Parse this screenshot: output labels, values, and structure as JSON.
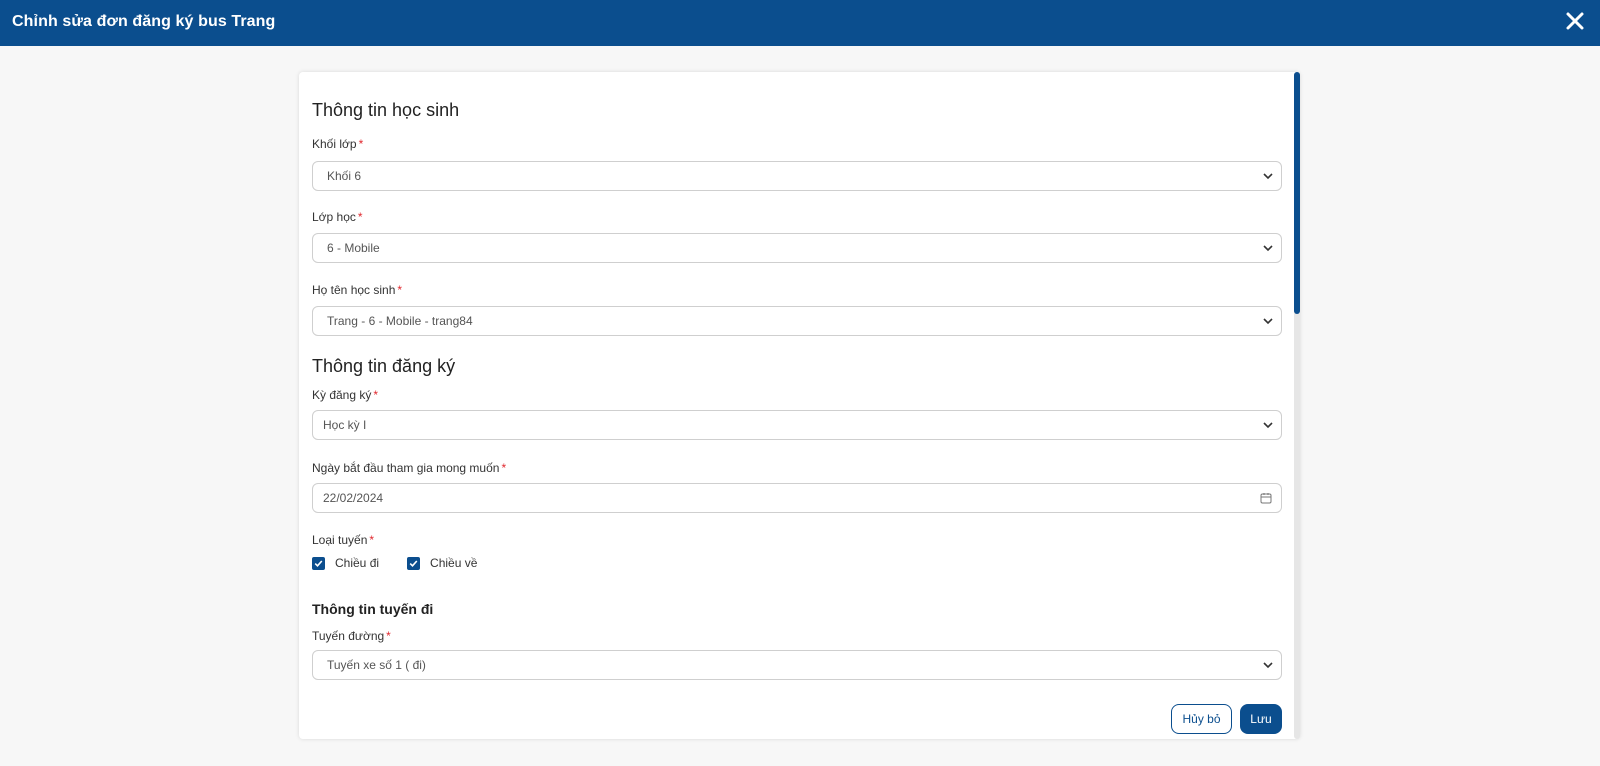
{
  "header": {
    "title": "Chỉnh sửa đơn đăng ký bus Trang",
    "close_icon": "close-icon"
  },
  "student_section": {
    "title": "Thông tin học sinh",
    "grade": {
      "label": "Khối lớp",
      "required": "*",
      "value": "Khối 6"
    },
    "class": {
      "label": "Lớp học",
      "required": "*",
      "value": "6 - Mobile"
    },
    "student": {
      "label": "Họ tên học sinh",
      "required": "*",
      "value": "Trang - 6 - Mobile - trang84"
    }
  },
  "registration_section": {
    "title": "Thông tin đăng ký",
    "term": {
      "label": "Kỳ đăng ký",
      "required": "*",
      "value": "Học kỳ I"
    },
    "start_date": {
      "label": "Ngày bắt đầu tham gia mong muốn",
      "required": "*",
      "value": "22/02/2024"
    },
    "route_type": {
      "label": "Loại tuyến",
      "required": "*",
      "options": [
        {
          "label": "Chiều đi",
          "checked": true
        },
        {
          "label": "Chiều về",
          "checked": true
        }
      ]
    }
  },
  "outbound_section": {
    "title": "Thông tin tuyến đi",
    "route": {
      "label": "Tuyến đường",
      "required": "*",
      "value": "Tuyến xe số 1 ( đi)"
    }
  },
  "actions": {
    "cancel_label": "Hủy bỏ",
    "save_label": "Lưu"
  },
  "colors": {
    "primary": "#0b4e8e",
    "required": "#e0282e",
    "page_bg": "#f7f7f7"
  }
}
